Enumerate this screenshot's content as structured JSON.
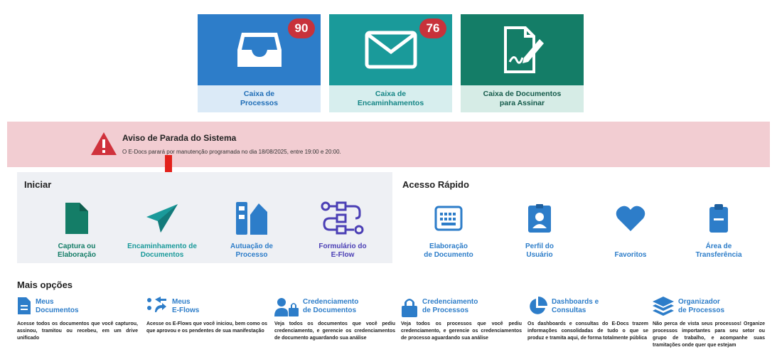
{
  "tiles": [
    {
      "label": "Caixa de\nProcessos",
      "badge": "90"
    },
    {
      "label": "Caixa de\nEncaminhamentos",
      "badge": "76"
    },
    {
      "label": "Caixa de Documentos\npara Assinar"
    }
  ],
  "alert": {
    "title": "Aviso de Parada do Sistema",
    "message": "O E-Docs parará por manutenção programada no dia 18/08/2025, entre 19:00 e 20:00."
  },
  "iniciar": {
    "title": "Iniciar",
    "items": [
      {
        "label": "Captura ou\nElaboração",
        "icon": "document-icon",
        "color": "#147d67"
      },
      {
        "label": "Encaminhamento de\nDocumentos",
        "icon": "paper-plane-icon",
        "color": "#1a9a9a"
      },
      {
        "label": "Autuação de\nProcesso",
        "icon": "process-icon",
        "color": "#2d7dc9"
      },
      {
        "label": "Formulário do\nE-Flow",
        "icon": "flow-icon",
        "color": "#4b3fb5"
      }
    ]
  },
  "acesso_rapido": {
    "title": "Acesso Rápido",
    "items": [
      {
        "label": "Elaboração\nde Documento",
        "icon": "keyboard-icon"
      },
      {
        "label": "Perfil do\nUsuário",
        "icon": "id-badge-icon"
      },
      {
        "label": "Favoritos",
        "icon": "heart-icon"
      },
      {
        "label": "Área de\nTransferência",
        "icon": "clipboard-icon"
      }
    ]
  },
  "mais_opcoes": {
    "title": "Mais opções",
    "items": [
      {
        "name": "Meus\nDocumentos",
        "icon": "my-documents-icon",
        "desc": "Acesse todos os documentos que você capturou, assinou, tramitou ou recebeu, em um drive unificado"
      },
      {
        "name": "Meus\nE-Flows",
        "icon": "eflows-icon",
        "desc": "Acesse os E-Flows que você iniciou, bem como os que aprovou e os pendentes de sua manifestação"
      },
      {
        "name": "Credenciamento\nde Documentos",
        "icon": "user-lock-icon",
        "desc": "Veja todos os documentos que você pediu credenciamento, e gerencie os credenciamentos de documento aguardando sua análise"
      },
      {
        "name": "Credenciamento\nde Processos",
        "icon": "lock-icon",
        "desc": "Veja todos os processos que você pediu credenciamento, e gerencie os credenciamentos de processo aguardando sua análise"
      },
      {
        "name": "Dashboards e\nConsultas",
        "icon": "pie-chart-icon",
        "desc": "Os dashboards e consultas do E-Docs trazem informações consolidadas de tudo o que se produz e tramita aqui, de forma totalmente pública"
      },
      {
        "name": "Organizador\nde Processos",
        "icon": "layers-icon",
        "desc": "Não perca de vista seus processos! Organize processos importantes para seu setor ou grupo de trabalho, e acompanhe suas tramitações onde quer que estejam"
      }
    ]
  },
  "colors": {
    "blue": "#2d7dc9",
    "teal": "#1a9a9a",
    "green": "#147d67",
    "badge": "#c8323b",
    "alert_bg": "#f2cdd2",
    "warning": "#d0323c",
    "arrow": "#e3211b"
  }
}
